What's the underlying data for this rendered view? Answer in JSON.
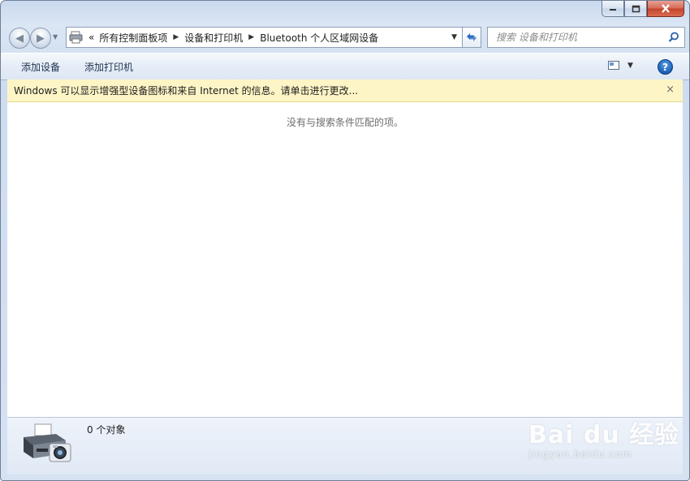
{
  "window": {
    "caption": {
      "minimize_icon": "minimize-icon",
      "maximize_icon": "maximize-icon",
      "close_icon": "close-icon"
    }
  },
  "address": {
    "overflow_chevron": "«",
    "crumbs": [
      "所有控制面板项",
      "设备和打印机",
      "Bluetooth 个人区域网设备"
    ]
  },
  "search": {
    "placeholder": "搜索 设备和打印机"
  },
  "command_bar": {
    "add_device": "添加设备",
    "add_printer": "添加打印机",
    "help": "?"
  },
  "infobar": {
    "message": "Windows 可以显示增强型设备图标和来自 Internet 的信息。请单击进行更改...",
    "close": "×"
  },
  "content": {
    "empty_message": "没有与搜索条件匹配的项。"
  },
  "details": {
    "count": "0 个对象"
  },
  "watermark": {
    "brand": "Bai du 经验",
    "url": "jingyan.baidu.com"
  },
  "colors": {
    "infobar_bg": "#fdf5c6",
    "close_button": "#c2432b",
    "accent": "#1c5fb8"
  }
}
